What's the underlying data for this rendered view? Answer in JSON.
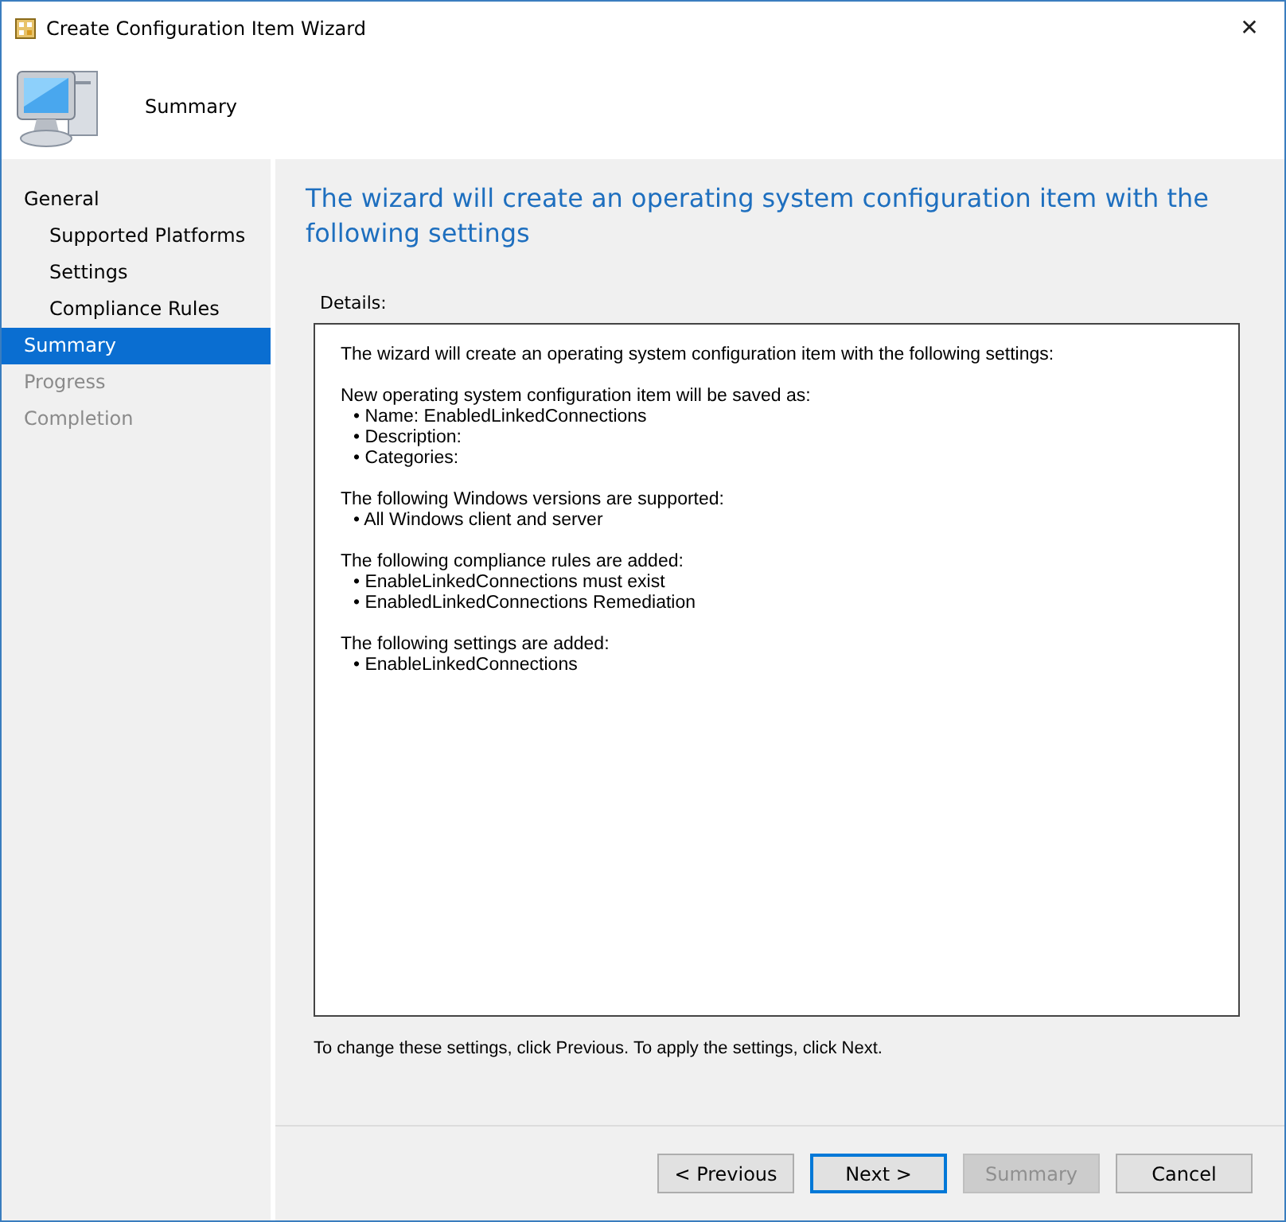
{
  "window": {
    "title": "Create Configuration Item Wizard",
    "close": "✕"
  },
  "header": {
    "title": "Summary"
  },
  "sidebar": {
    "items": [
      {
        "label": "General",
        "selected": false,
        "disabled": false,
        "children": [
          {
            "label": "Supported Platforms",
            "selected": false,
            "disabled": false
          },
          {
            "label": "Settings",
            "selected": false,
            "disabled": false
          },
          {
            "label": "Compliance Rules",
            "selected": false,
            "disabled": false
          }
        ]
      },
      {
        "label": "Summary",
        "selected": true,
        "disabled": false
      },
      {
        "label": "Progress",
        "selected": false,
        "disabled": true
      },
      {
        "label": "Completion",
        "selected": false,
        "disabled": true
      }
    ]
  },
  "content": {
    "heading": "The wizard will create an operating system configuration item with the following settings",
    "details_label": "Details:",
    "details": {
      "intro": "The wizard will create an operating system configuration item with the following settings:",
      "sections": [
        {
          "heading": "New operating system configuration item will be saved as:",
          "items": [
            "• Name: EnabledLinkedConnections",
            "• Description:",
            "• Categories:"
          ]
        },
        {
          "heading": "The following Windows versions are supported:",
          "items": [
            "• All Windows client and server"
          ]
        },
        {
          "heading": "The following compliance rules are added:",
          "items": [
            "• EnableLinkedConnections must exist",
            "• EnabledLinkedConnections Remediation"
          ]
        },
        {
          "heading": "The following settings are added:",
          "items": [
            "• EnableLinkedConnections"
          ]
        }
      ]
    },
    "hint": "To change these settings, click Previous. To apply the settings, click Next."
  },
  "buttons": [
    {
      "label": "< Previous",
      "default": false,
      "disabled": false
    },
    {
      "label": "Next >",
      "default": true,
      "disabled": false
    },
    {
      "label": "Summary",
      "default": false,
      "disabled": true
    },
    {
      "label": "Cancel",
      "default": false,
      "disabled": false
    }
  ]
}
